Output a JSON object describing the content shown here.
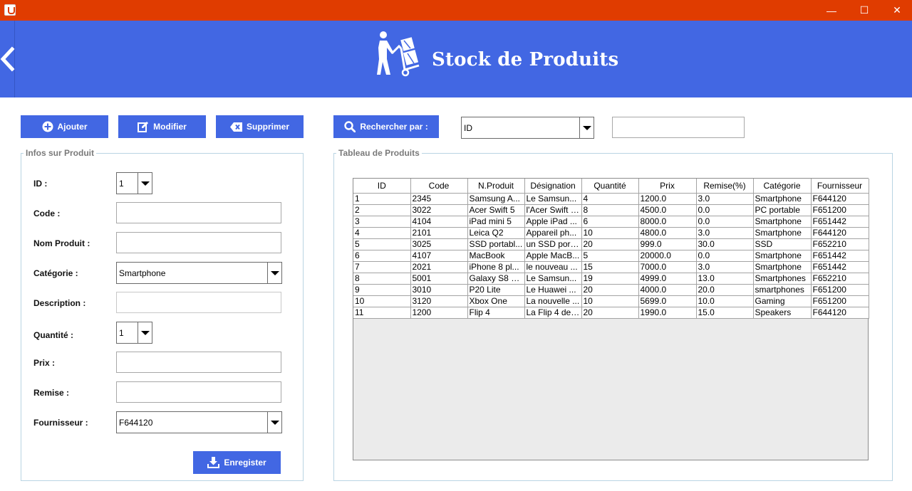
{
  "window": {
    "minimize": "—",
    "maximize": "☐",
    "close": "✕"
  },
  "header": {
    "title": "Stock de Produits"
  },
  "toolbar": {
    "add_label": "Ajouter",
    "edit_label": "Modifier",
    "delete_label": "Supprimer",
    "search_label": "Rechercher par :",
    "search_by_value": "ID",
    "search_text": ""
  },
  "form": {
    "legend": "Infos sur Produit",
    "id_label": "ID :",
    "id_value": "1",
    "code_label": "Code :",
    "name_label": "Nom Produit :",
    "category_label": "Catégorie :",
    "category_value": "Smartphone",
    "description_label": "Description :",
    "quantity_label": "Quantité :",
    "quantity_value": "1",
    "price_label": "Prix :",
    "discount_label": "Remise :",
    "supplier_label": "Fournisseur :",
    "supplier_value": "F644120",
    "save_label": "Enregister"
  },
  "table": {
    "legend": "Tableau de Produits",
    "columns": [
      "ID",
      "Code",
      "N.Produit",
      "Désignation",
      "Quantité",
      "Prix",
      "Remise(%)",
      "Catégorie",
      "Fournisseur"
    ],
    "rows": [
      [
        "1",
        "2345",
        "Samsung A...",
        "Le Samsun...",
        "4",
        "1200.0",
        "3.0",
        "Smartphone",
        "F644120"
      ],
      [
        "2",
        "3022",
        "Acer Swift 5",
        "l'Acer Swift 5...",
        "8",
        "4500.0",
        "0.0",
        "PC portable",
        "F651200"
      ],
      [
        "3",
        "4104",
        " iPad mini 5",
        "Apple iPad ...",
        "6",
        "8000.0",
        "0.0",
        "Smartphone",
        "F651442"
      ],
      [
        "4",
        "2101",
        "Leica Q2",
        "Appareil ph...",
        "10",
        "4800.0",
        "3.0",
        "Smartphone",
        "F644120"
      ],
      [
        "5",
        "3025",
        "SSD portabl...",
        "un SSD port...",
        "20",
        "999.0",
        "30.0",
        "SSD",
        "F652210"
      ],
      [
        "6",
        "4107",
        "MacBook",
        "Apple MacB...",
        "5",
        "20000.0",
        "0.0",
        "Smartphone",
        "F651442"
      ],
      [
        "7",
        "2021",
        " iPhone 8 pl...",
        "le nouveau ...",
        "15",
        "7000.0",
        "3.0",
        "Smartphone",
        "F651442"
      ],
      [
        "8",
        "5001",
        "Galaxy S8 Pl...",
        "Le Samsun...",
        "19",
        "4999.0",
        "13.0",
        "Smartphones",
        "F652210"
      ],
      [
        "9",
        "3010",
        "P20 Lite",
        "Le Huawei ...",
        "20",
        "4000.0",
        "20.0",
        "smartphones",
        "F651200"
      ],
      [
        "10",
        "3120",
        "Xbox One",
        "La nouvelle ...",
        "10",
        "5699.0",
        "10.0",
        "Gaming",
        "F651200"
      ],
      [
        "11",
        "1200",
        "Flip 4",
        "La Flip 4 de ...",
        "20",
        "1990.0",
        "15.0",
        "Speakers",
        "F644120"
      ]
    ]
  }
}
